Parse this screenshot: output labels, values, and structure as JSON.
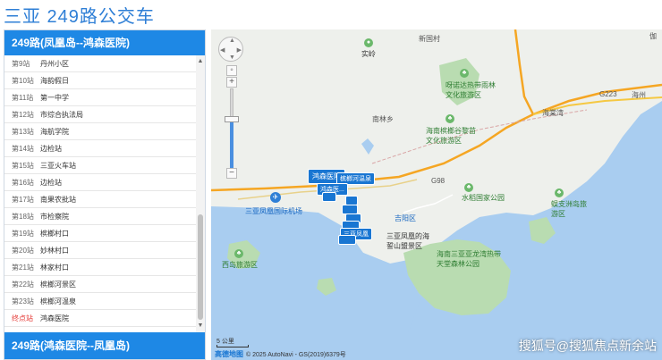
{
  "page": {
    "title": "三亚 249路公交车"
  },
  "panel": {
    "route_forward": "249路(凤凰岛--鸿森医院)",
    "route_reverse": "249路(鸿森医院--凤凰岛)",
    "stops": [
      {
        "num": "第9站",
        "name": "丹州小区"
      },
      {
        "num": "第10站",
        "name": "海韵假日"
      },
      {
        "num": "第11站",
        "name": "第一中学"
      },
      {
        "num": "第12站",
        "name": "市综合执法局"
      },
      {
        "num": "第13站",
        "name": "海航学院"
      },
      {
        "num": "第14站",
        "name": "边检站"
      },
      {
        "num": "第15站",
        "name": "三亚火车站"
      },
      {
        "num": "第16站",
        "name": "边检站"
      },
      {
        "num": "第17站",
        "name": "南果农批站"
      },
      {
        "num": "第18站",
        "name": "市检察院"
      },
      {
        "num": "第19站",
        "name": "槟榔村口"
      },
      {
        "num": "第20站",
        "name": "妙林村口"
      },
      {
        "num": "第21站",
        "name": "林家村口"
      },
      {
        "num": "第22站",
        "name": "槟榔河景区"
      },
      {
        "num": "第23站",
        "name": "槟榔河温泉"
      },
      {
        "num": "终点站",
        "name": "鸿森医院"
      }
    ]
  },
  "map": {
    "labels": {
      "shiling": "实岭",
      "xinguocun": "新国村",
      "yinggeling": "伽",
      "yalong_forest": "呀诺达热带雨林文化旅游区",
      "nanlin": "南林乡",
      "haitang_bay": "海棠湾",
      "binglang_valley": "海南槟榔谷黎苗文化旅游区",
      "water_park": "水稻国家公园",
      "sanya_airport": "三亚凤凰国际机场",
      "jiyang": "吉阳区",
      "fenghuang_sea": "三亚凤凰的海誓山盟景区",
      "luhuitou": "海南三亚亚龙湾热带天堂森林公园",
      "xidao": "西岛旅游区",
      "yalong_bay": "蜈支洲岛旅游区",
      "road_g98": "G98",
      "road_g223": "G223",
      "haizhou": "海州"
    },
    "markers": {
      "hongsen": "鸿森医院",
      "wenquan": "槟榔河温泉",
      "stack_a": "鸿森医...",
      "stack_b": "三亚凤凰"
    },
    "scale": "5 公里",
    "copyright": "© 2025 AutoNavi - GS(2019)6379号",
    "logo": "高德地图",
    "watermark": "搜狐号@搜狐焦点新余站"
  },
  "colors": {
    "accent": "#1e88e5",
    "title": "#2f7fd6",
    "terminal": "#e53935",
    "sea": "#a9cdf0",
    "land": "#eef0ec",
    "green": "#b9dcb1"
  }
}
